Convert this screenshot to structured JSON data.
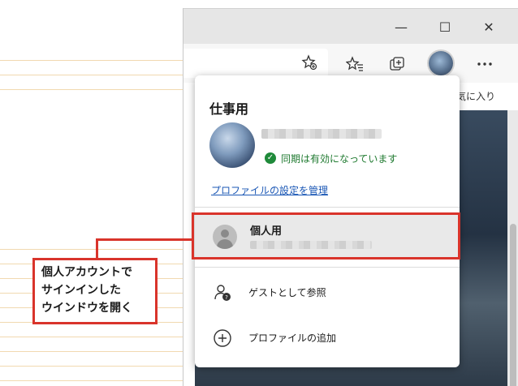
{
  "toolbar": {
    "favorites_partial": "気に入り"
  },
  "window_controls": {
    "minimize": "—",
    "maximize": "☐",
    "close": "✕"
  },
  "profile_panel": {
    "title": "仕事用",
    "sync_status": "同期は有効になっています",
    "manage_link": "プロファイルの設定を管理",
    "personal_profile_name": "個人用",
    "guest_label": "ゲストとして参照",
    "add_profile_label": "プロファイルの追加"
  },
  "callout": {
    "lines": [
      "個人アカウントで",
      "サインインした",
      "ウインドウを開く"
    ]
  },
  "colors": {
    "highlight_red": "#d9342b",
    "sync_green": "#1f7a30",
    "link_blue": "#1a57b5"
  },
  "icons": [
    "add-favorite-icon",
    "favorites-icon",
    "collections-icon",
    "more-icon",
    "sync-check-icon",
    "guest-person-icon",
    "add-profile-icon"
  ]
}
